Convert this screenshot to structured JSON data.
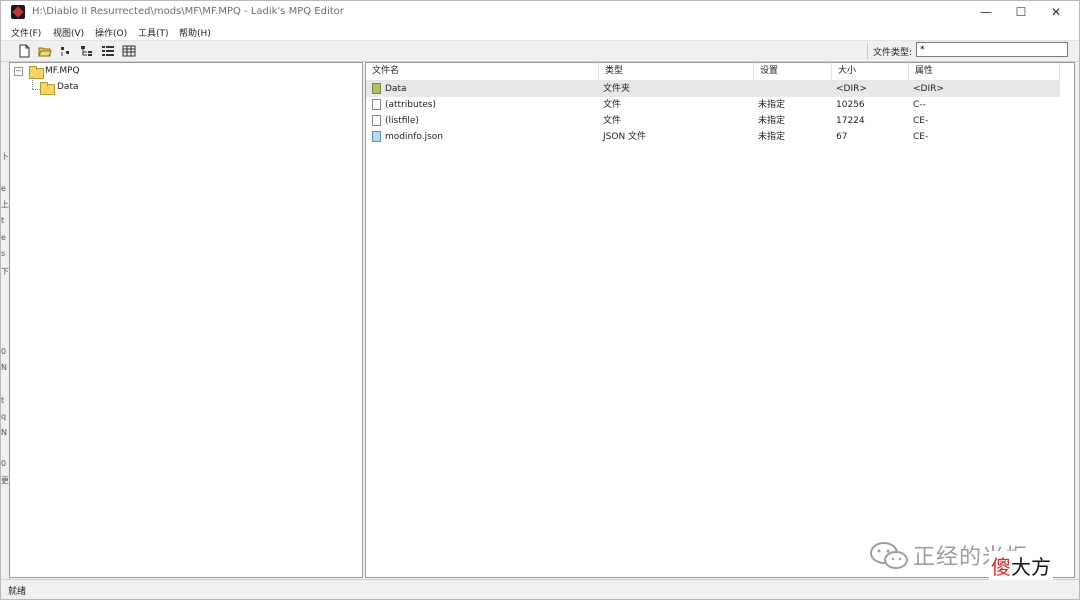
{
  "window": {
    "title": "H:\\Diablo II Resurrected\\mods\\MF\\MF.MPQ - Ladik's MPQ Editor",
    "min_glyph": "—",
    "max_glyph": "☐",
    "close_glyph": "✕"
  },
  "menu": {
    "file": "文件(F)",
    "view": "视图(V)",
    "operation": "操作(O)",
    "tools": "工具(T)",
    "help": "帮助(H)"
  },
  "toolbar": {
    "filetype_label": "文件类型:",
    "filetype_value": "*"
  },
  "tree": {
    "root_toggle": "−",
    "root_label": "MF.MPQ",
    "child_label": "Data"
  },
  "list": {
    "columns": {
      "name": "文件名",
      "type": "类型",
      "settings": "设置",
      "size": "大小",
      "attributes": "属性"
    },
    "rows": [
      {
        "name": "Data",
        "type": "文件夹",
        "settings": "",
        "size": "<DIR>",
        "attributes": "<DIR>",
        "icon": "folder-icon"
      },
      {
        "name": "(attributes)",
        "type": "文件",
        "settings": "未指定",
        "size": "10256",
        "attributes": "C--",
        "icon": "file-icon"
      },
      {
        "name": "(listfile)",
        "type": "文件",
        "settings": "未指定",
        "size": "17224",
        "attributes": "CE-",
        "icon": "file-icon"
      },
      {
        "name": "modinfo.json",
        "type": "JSON 文件",
        "settings": "未指定",
        "size": "67",
        "attributes": "CE-",
        "icon": "json-file-icon"
      }
    ]
  },
  "status": {
    "text": "就绪"
  },
  "edge_chars": [
    "卜",
    "e",
    "上",
    "t",
    "e",
    "s",
    "下",
    "0",
    "N",
    "t",
    "q",
    "N",
    "0",
    "更"
  ],
  "watermark": {
    "text": "正经的米炬",
    "badge_red": "傻",
    "badge_black": "大方"
  }
}
